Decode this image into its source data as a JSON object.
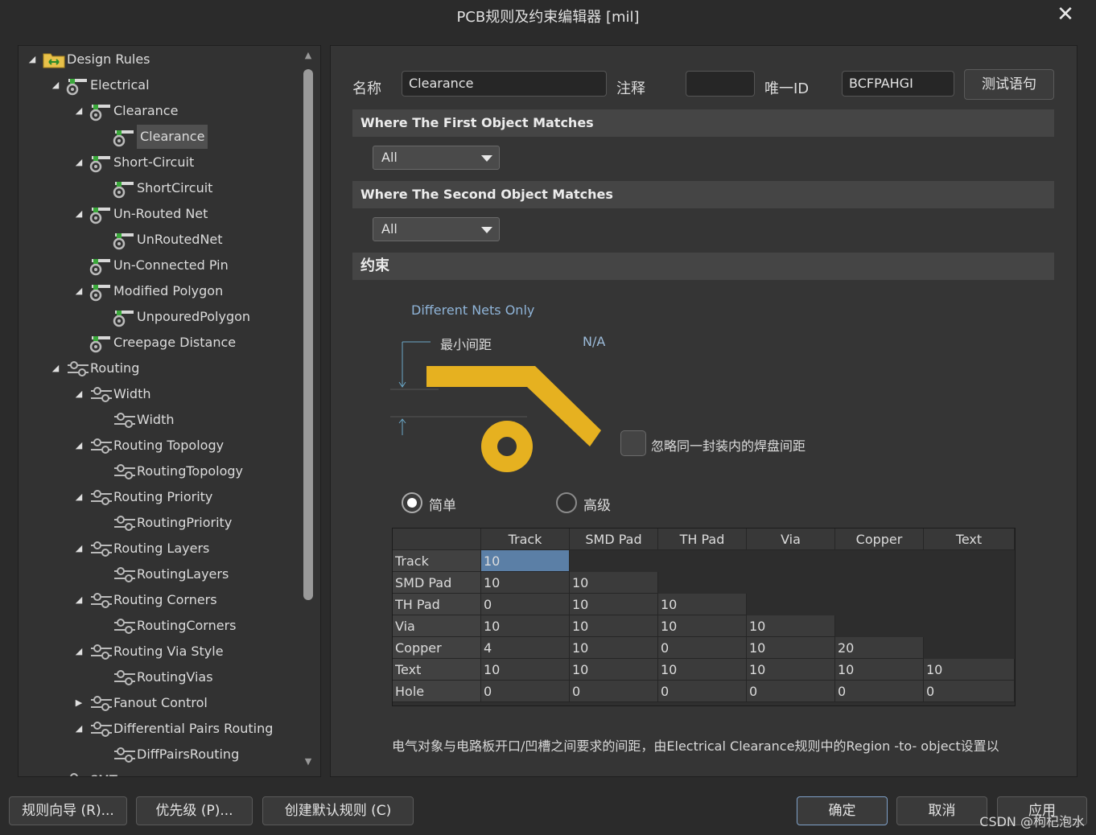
{
  "window": {
    "title": "PCB规则及约束编辑器 [mil]",
    "close": "✕"
  },
  "tree": [
    {
      "label": "Design Rules",
      "exp": "◢",
      "icon": "folder",
      "level": 0
    },
    {
      "label": "Electrical",
      "exp": "◢",
      "icon": "rule",
      "level": 1
    },
    {
      "label": "Clearance",
      "exp": "◢",
      "icon": "rule",
      "level": 2
    },
    {
      "label": "Clearance",
      "exp": "",
      "icon": "rule",
      "level": 3,
      "selected": true
    },
    {
      "label": "Short-Circuit",
      "exp": "◢",
      "icon": "rule",
      "level": 2
    },
    {
      "label": "ShortCircuit",
      "exp": "",
      "icon": "rule",
      "level": 3
    },
    {
      "label": "Un-Routed Net",
      "exp": "◢",
      "icon": "rule",
      "level": 2
    },
    {
      "label": "UnRoutedNet",
      "exp": "",
      "icon": "rule",
      "level": 3
    },
    {
      "label": "Un-Connected Pin",
      "exp": "",
      "icon": "rule",
      "level": 2
    },
    {
      "label": "Modified Polygon",
      "exp": "◢",
      "icon": "rule",
      "level": 2
    },
    {
      "label": "UnpouredPolygon",
      "exp": "",
      "icon": "rule",
      "level": 3
    },
    {
      "label": "Creepage Distance",
      "exp": "",
      "icon": "rule",
      "level": 2
    },
    {
      "label": "Routing",
      "exp": "◢",
      "icon": "route",
      "level": 1
    },
    {
      "label": "Width",
      "exp": "◢",
      "icon": "route",
      "level": 2
    },
    {
      "label": "Width",
      "exp": "",
      "icon": "route",
      "level": 3
    },
    {
      "label": "Routing Topology",
      "exp": "◢",
      "icon": "route",
      "level": 2
    },
    {
      "label": "RoutingTopology",
      "exp": "",
      "icon": "route",
      "level": 3
    },
    {
      "label": "Routing Priority",
      "exp": "◢",
      "icon": "route",
      "level": 2
    },
    {
      "label": "RoutingPriority",
      "exp": "",
      "icon": "route",
      "level": 3
    },
    {
      "label": "Routing Layers",
      "exp": "◢",
      "icon": "route",
      "level": 2
    },
    {
      "label": "RoutingLayers",
      "exp": "",
      "icon": "route",
      "level": 3
    },
    {
      "label": "Routing Corners",
      "exp": "◢",
      "icon": "route",
      "level": 2
    },
    {
      "label": "RoutingCorners",
      "exp": "",
      "icon": "route",
      "level": 3
    },
    {
      "label": "Routing Via Style",
      "exp": "◢",
      "icon": "route",
      "level": 2
    },
    {
      "label": "RoutingVias",
      "exp": "",
      "icon": "route",
      "level": 3
    },
    {
      "label": "Fanout Control",
      "exp": "▶",
      "icon": "route",
      "level": 2
    },
    {
      "label": "Differential Pairs Routing",
      "exp": "◢",
      "icon": "route",
      "level": 2
    },
    {
      "label": "DiffPairsRouting",
      "exp": "",
      "icon": "route",
      "level": 3
    },
    {
      "label": "SMT",
      "exp": "◢",
      "icon": "route",
      "level": 1
    }
  ],
  "header": {
    "name_label": "名称",
    "name_value": "Clearance",
    "comment_label": "注释",
    "comment_value": "",
    "uid_label": "唯一ID",
    "uid_value": "BCFPAHGI",
    "test_button": "测试语句"
  },
  "first_match": {
    "title": "Where The First Object Matches",
    "value": "All"
  },
  "second_match": {
    "title": "Where The Second Object Matches",
    "value": "All"
  },
  "constraints": {
    "title": "约束",
    "nets_mode": "Different Nets Only",
    "min_clearance_label": "最小间距",
    "min_clearance_value": "N/A",
    "ignore_pads_label": "忽略同一封装内的焊盘间距",
    "radio_simple": "简单",
    "radio_advanced": "高级",
    "radio_selected": "简单",
    "pcb_color": "#e6b120"
  },
  "matrix": {
    "columns": [
      "Track",
      "SMD Pad",
      "TH Pad",
      "Via",
      "Copper",
      "Text"
    ],
    "rows": [
      {
        "name": "Track",
        "values": [
          "10"
        ]
      },
      {
        "name": "SMD Pad",
        "values": [
          "10",
          "10"
        ]
      },
      {
        "name": "TH Pad",
        "values": [
          "0",
          "10",
          "10"
        ]
      },
      {
        "name": "Via",
        "values": [
          "10",
          "10",
          "10",
          "10"
        ]
      },
      {
        "name": "Copper",
        "values": [
          "4",
          "10",
          "0",
          "10",
          "20"
        ]
      },
      {
        "name": "Text",
        "values": [
          "10",
          "10",
          "10",
          "10",
          "10",
          "10"
        ]
      },
      {
        "name": "Hole",
        "values": [
          "0",
          "0",
          "0",
          "0",
          "0",
          "0"
        ]
      }
    ]
  },
  "description": "电气对象与电路板开口/凹槽之间要求的间距，由Electrical Clearance规则中的Region -to- object设置以",
  "footer": {
    "rule_wizard": "规则向导 (R)...",
    "priorities": "优先级 (P)...",
    "create_default": "创建默认规则 (C)",
    "ok": "确定",
    "cancel": "取消",
    "apply": "应用"
  },
  "watermark": "CSDN @枸杞泡水"
}
